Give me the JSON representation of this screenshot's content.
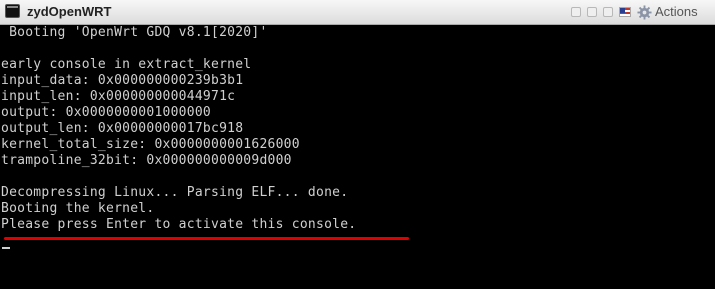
{
  "window": {
    "title": "zydOpenWRT",
    "actions_label": "Actions",
    "actions_icon": "gear-icon",
    "flag_icon": "us-flag-icon"
  },
  "console": {
    "lines": [
      " Booting 'OpenWrt GDQ v8.1[2020]'",
      "",
      "early console in extract_kernel",
      "input_data: 0x000000000239b3b1",
      "input_len: 0x000000000044971c",
      "output: 0x0000000001000000",
      "output_len: 0x00000000017bc918",
      "kernel_total_size: 0x0000000001626000",
      "trampoline_32bit: 0x000000000009d000",
      "",
      "Decompressing Linux... Parsing ELF... done.",
      "Booting the kernel.",
      "Please press Enter to activate this console."
    ],
    "text_color": "#d0d0d0",
    "background": "#000000",
    "highlight_color": "#e00000"
  }
}
